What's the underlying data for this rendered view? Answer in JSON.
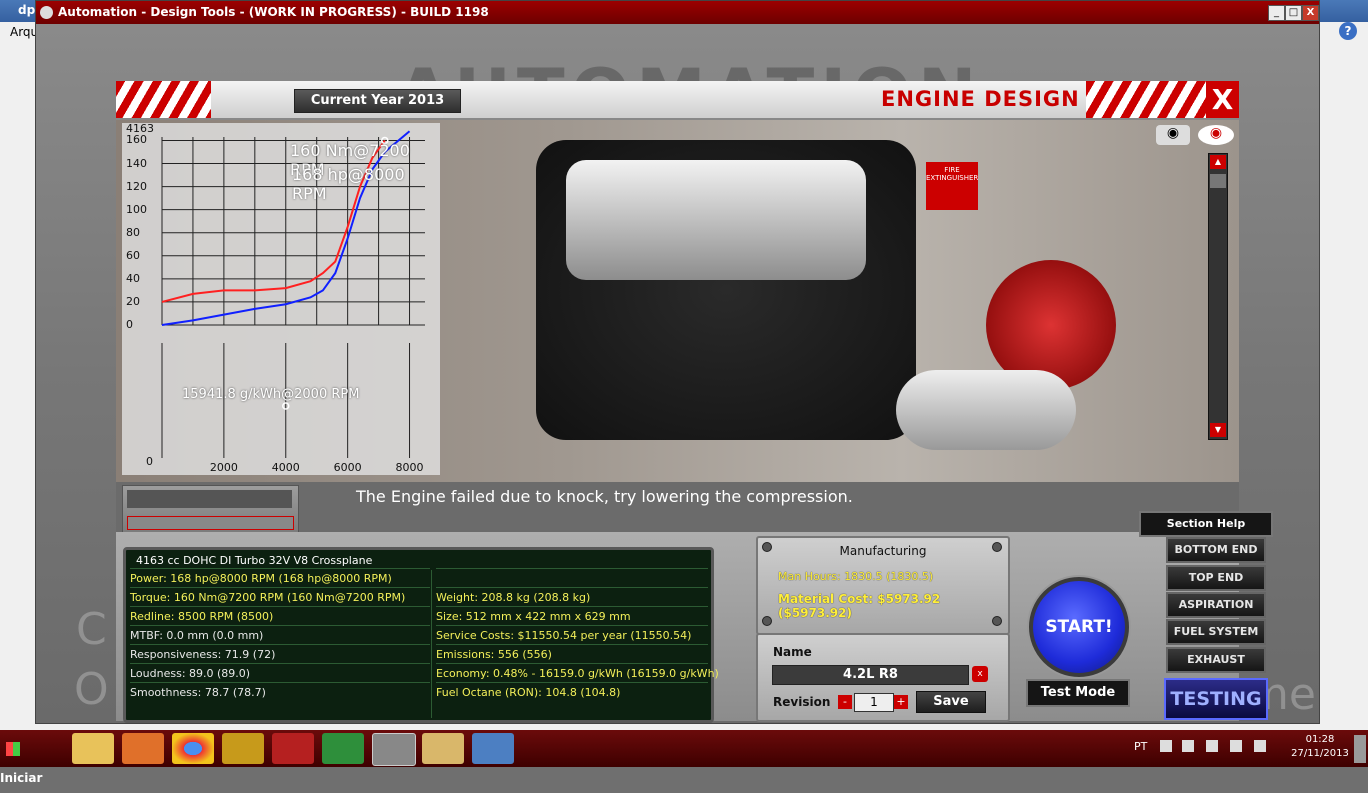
{
  "bg_window": {
    "title": "dp",
    "menu_first": "Arqu",
    "help_label": "?"
  },
  "window": {
    "title": "Automation - Design Tools - (WORK IN PROGRESS) - BUILD 1198",
    "minimize": "_",
    "maximize": "□",
    "close": "X"
  },
  "backdrop": {
    "logo": "AUTOMATION",
    "ghost_left_1": "C",
    "ghost_left_2": "O",
    "ghost_right": "me"
  },
  "header": {
    "current_year": "Current Year 2013",
    "title": "ENGINE DESIGN",
    "close_label": "X"
  },
  "graph": {
    "peak_torque": "160 Nm@7200 RPM",
    "peak_power": "168 hp@8000 RPM",
    "econ_label": "15941.8 g/kWh@2000 RPM",
    "y_ticks": [
      "0",
      "20",
      "40",
      "60",
      "80",
      "100",
      "120",
      "140",
      "160",
      "4163"
    ],
    "x_ticks": [
      "0",
      "2000",
      "4000",
      "6000",
      "8000"
    ]
  },
  "chart_data": {
    "type": "line",
    "title": "",
    "xlabel": "",
    "ylabel": "",
    "xlim": [
      0,
      8500
    ],
    "ylim": [
      0,
      163
    ],
    "series": [
      {
        "color": "#ff2020",
        "x": [
          0,
          1000,
          2000,
          3000,
          4000,
          4800,
          5200,
          5600,
          6000,
          6400,
          6800,
          7200
        ],
        "values": [
          20,
          27,
          30,
          30,
          32,
          38,
          45,
          55,
          85,
          120,
          145,
          160
        ]
      },
      {
        "color": "#1020ff",
        "x": [
          0,
          1000,
          2000,
          3000,
          4000,
          4800,
          5200,
          5600,
          6000,
          6400,
          6800,
          7200,
          8000
        ],
        "values": [
          0,
          4,
          9,
          14,
          18,
          24,
          30,
          45,
          75,
          110,
          135,
          150,
          168
        ]
      }
    ]
  },
  "message": "The Engine failed due to knock, try lowering the compression.",
  "stats": {
    "caption": "4163 cc DOHC DI Turbo 32V V8 Crossplane",
    "left": [
      "Power: 168 hp@8000 RPM (168 hp@8000 RPM)",
      "Torque: 160 Nm@7200 RPM (160 Nm@7200 RPM)",
      "Redline: 8500 RPM (8500)",
      "MTBF: 0.0 mm (0.0 mm)",
      "Responsiveness: 71.9 (72)",
      "Loudness: 89.0 (89.0)",
      "Smoothness: 78.7 (78.7)"
    ],
    "right": [
      "",
      "Weight: 208.8 kg (208.8 kg)",
      "Size: 512 mm x 422 mm x 629 mm",
      "Service Costs: $11550.54 per year (11550.54)",
      "Emissions: 556 (556)",
      "Economy: 0.48% - 16159.0 g/kWh (16159.0 g/kWh)",
      "Fuel Octane (RON): 104.8 (104.8)"
    ]
  },
  "manufacturing": {
    "title": "Manufacturing",
    "man_hours": "Man Hours: 1830.5 (1830.5)",
    "material_cost": "Material Cost: $5973.92 ($5973.92)"
  },
  "name_panel": {
    "label": "Name",
    "value": "4.2L R8",
    "delete_label": "x",
    "revision_label": "Revision",
    "revision_value": "1",
    "minus": "-",
    "plus": "+",
    "save": "Save"
  },
  "start": "START!",
  "test_mode": "Test Mode",
  "section_help": "Section Help",
  "sections": [
    "BOTTOM END",
    "TOP END",
    "ASPIRATION",
    "FUEL SYSTEM",
    "EXHAUST"
  ],
  "testing": "TESTING",
  "viewport": {
    "sign": "FIRE EXTINGUISHER"
  },
  "taskbar": {
    "start": "Iniciar",
    "lang": "PT",
    "time": "01:28",
    "date": "27/11/2013"
  }
}
